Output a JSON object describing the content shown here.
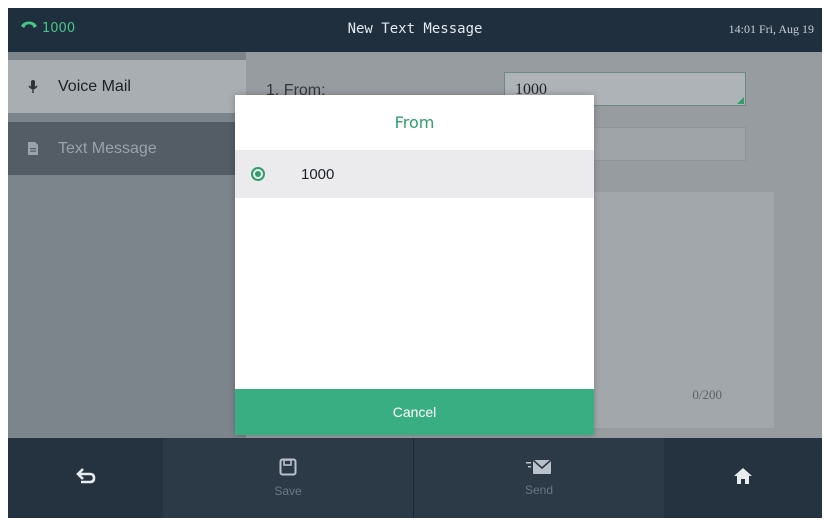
{
  "status": {
    "line_icon": "phone-icon",
    "line_number": "1000",
    "title": "New Text Message",
    "datetime": "14:01 Fri, Aug 19"
  },
  "sidebar": {
    "items": [
      {
        "label": "Voice Mail",
        "icon": "microphone-icon",
        "selected": false
      },
      {
        "label": "Text Message",
        "icon": "document-icon",
        "selected": true
      }
    ]
  },
  "form": {
    "from_label": "1. From:",
    "from_value": "1000",
    "counter": "0/200"
  },
  "dialog": {
    "title": "From",
    "options": [
      {
        "label": "1000",
        "selected": true
      }
    ],
    "cancel_label": "Cancel"
  },
  "softkeys": {
    "back_icon": "back-arrow-icon",
    "save_label": "Save",
    "send_label": "Send",
    "home_icon": "home-icon"
  },
  "colors": {
    "accent": "#3aae83",
    "status_bar": "#1f2f3d",
    "soft_bar": "#25323f"
  }
}
